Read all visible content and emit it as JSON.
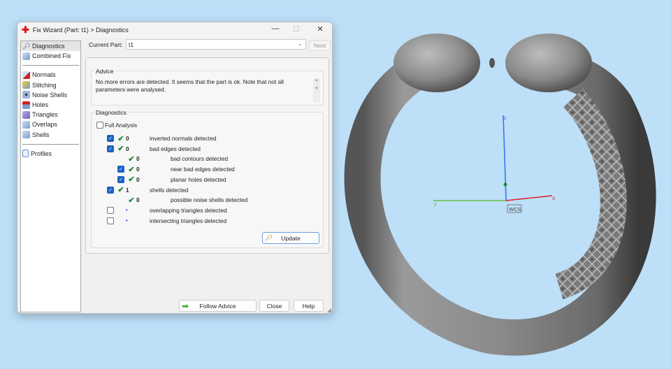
{
  "dialog": {
    "title": "Fix Wizard (Part: t1) > Diagnostics",
    "window_buttons": {
      "minimize": "—",
      "maximize": "☐",
      "close": "✕"
    },
    "nav": {
      "group1": [
        {
          "label": "Diagnostics",
          "selected": true
        },
        {
          "label": "Combined Fix"
        }
      ],
      "group2": [
        {
          "label": "Normals"
        },
        {
          "label": "Stitching"
        },
        {
          "label": "Noise Shells"
        },
        {
          "label": "Holes"
        },
        {
          "label": "Triangles"
        },
        {
          "label": "Overlaps"
        },
        {
          "label": "Shells"
        }
      ],
      "group3": [
        {
          "label": "Profiles"
        }
      ]
    },
    "current_part_label": "Current Part:",
    "current_part_value": "t1",
    "next_label": "Next",
    "advice": {
      "title": "Advice",
      "text": "No more errors are detected. It seems that the part is ok. Note that not all parameters were analysed."
    },
    "diagnostics": {
      "title": "Diagnostics",
      "full_analysis_label": "Full Analysis",
      "full_analysis_checked": false,
      "rows": [
        {
          "checkbox": true,
          "checked": true,
          "status": "ok",
          "count": "0",
          "label": "inverted normals detected",
          "indent": 0
        },
        {
          "checkbox": true,
          "checked": true,
          "status": "ok",
          "count": "0",
          "label": "bad edges detected",
          "indent": 0
        },
        {
          "checkbox": false,
          "checked": false,
          "status": "ok",
          "count": "0",
          "label": "bad contours detected",
          "indent": 1
        },
        {
          "checkbox": true,
          "checked": true,
          "status": "ok",
          "count": "0",
          "label": "near bad edges detected",
          "indent": 1
        },
        {
          "checkbox": true,
          "checked": true,
          "status": "ok",
          "count": "0",
          "label": "planar holes detected",
          "indent": 1
        },
        {
          "checkbox": true,
          "checked": true,
          "status": "ok",
          "count": "1",
          "label": "shells detected",
          "indent": 0
        },
        {
          "checkbox": false,
          "checked": false,
          "status": "ok",
          "count": "0",
          "label": "possible noise shells detected",
          "indent": 1
        },
        {
          "checkbox": true,
          "checked": false,
          "status": "pending",
          "count": "•",
          "label": "overlapping triangles detected",
          "indent": 0
        },
        {
          "checkbox": true,
          "checked": false,
          "status": "pending",
          "count": "•",
          "label": "intersecting triangles detected",
          "indent": 0
        }
      ],
      "update_label": "Update"
    },
    "footer": {
      "follow_advice": "Follow Advice",
      "close": "Close",
      "help": "Help"
    }
  },
  "viewport": {
    "axes": {
      "x": "x",
      "y": "y",
      "z": "z"
    },
    "wcs_label": "WCS",
    "colors": {
      "x": "#e02020",
      "y": "#60c040",
      "z": "#3070f0",
      "background": "#bddff8",
      "model": "#8a8a8a"
    }
  }
}
